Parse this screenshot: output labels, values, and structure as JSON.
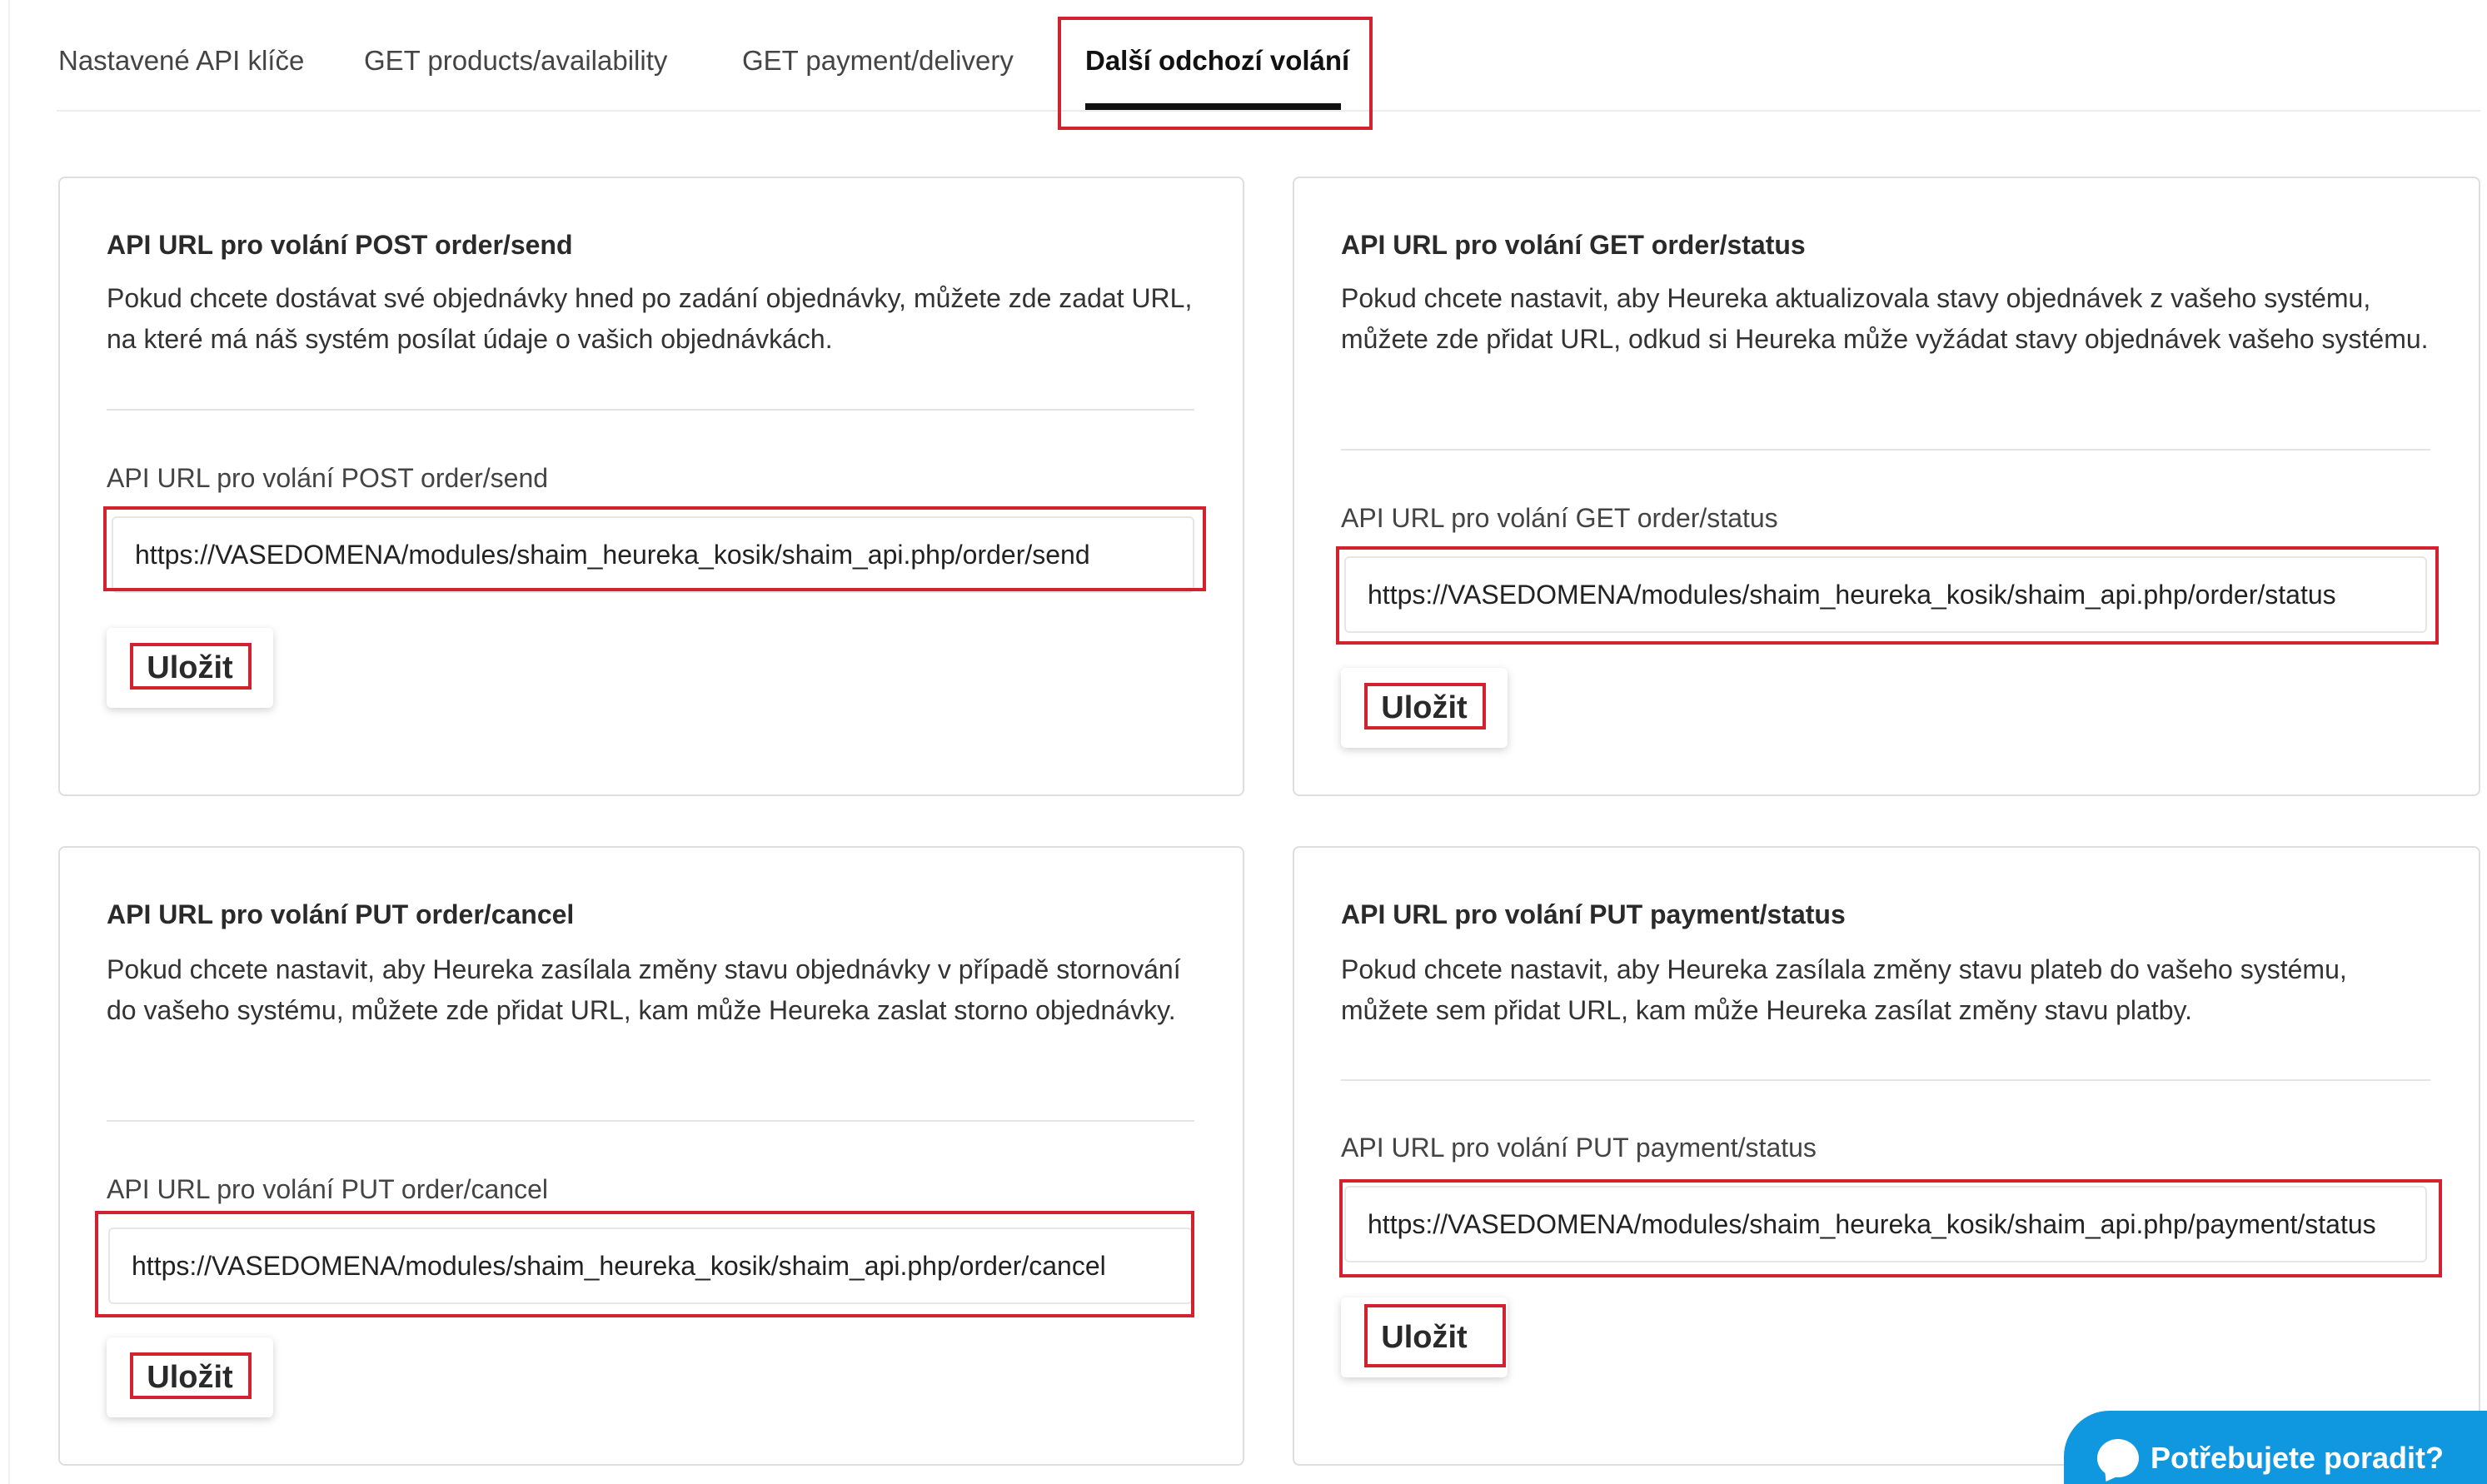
{
  "tabs": [
    {
      "label": "Nastavené API klíče"
    },
    {
      "label": "GET products/availability"
    },
    {
      "label": "GET payment/delivery"
    },
    {
      "label": "Další odchozí volání"
    }
  ],
  "cards": [
    {
      "title": "API URL pro volání POST order/send",
      "description": "Pokud chcete dostávat své objednávky hned po zadání objednávky, můžete zde zadat URL, na které má náš systém posílat údaje o vašich objednávkách.",
      "field_label": "API URL pro volání POST order/send",
      "url_value": "https://VASEDOMENA/modules/shaim_heureka_kosik/shaim_api.php/order/send",
      "save_label": "Uložit"
    },
    {
      "title": "API URL pro volání GET order/status",
      "description": "Pokud chcete nastavit, aby Heureka aktualizovala stavy objednávek z vašeho systému, můžete zde přidat URL, odkud si Heureka může vyžádat stavy objednávek vašeho systému.",
      "field_label": "API URL pro volání GET order/status",
      "url_value": "https://VASEDOMENA/modules/shaim_heureka_kosik/shaim_api.php/order/status",
      "save_label": "Uložit"
    },
    {
      "title": "API URL pro volání PUT order/cancel",
      "description": "Pokud chcete nastavit, aby Heureka zasílala změny stavu objednávky v případě stornování do vašeho systému, můžete zde přidat URL, kam může Heureka zaslat storno objednávky.",
      "field_label": "API URL pro volání PUT order/cancel",
      "url_value": "https://VASEDOMENA/modules/shaim_heureka_kosik/shaim_api.php/order/cancel",
      "save_label": "Uložit"
    },
    {
      "title": "API URL pro volání PUT payment/status",
      "description": "Pokud chcete nastavit, aby Heureka zasílala změny stavu plateb do vašeho systému, můžete sem přidat URL, kam může Heureka zasílat změny stavu platby.",
      "field_label": "API URL pro volání PUT payment/status",
      "url_value": "https://VASEDOMENA/modules/shaim_heureka_kosik/shaim_api.php/payment/status",
      "save_label": "Uložit"
    }
  ],
  "chat": {
    "label": "Potřebujete poradit?",
    "icon": "chat-bubble-icon"
  },
  "colors": {
    "highlight": "#d3222f",
    "chat_bg": "#0f97e0",
    "active_tab_underline": "#111111"
  }
}
